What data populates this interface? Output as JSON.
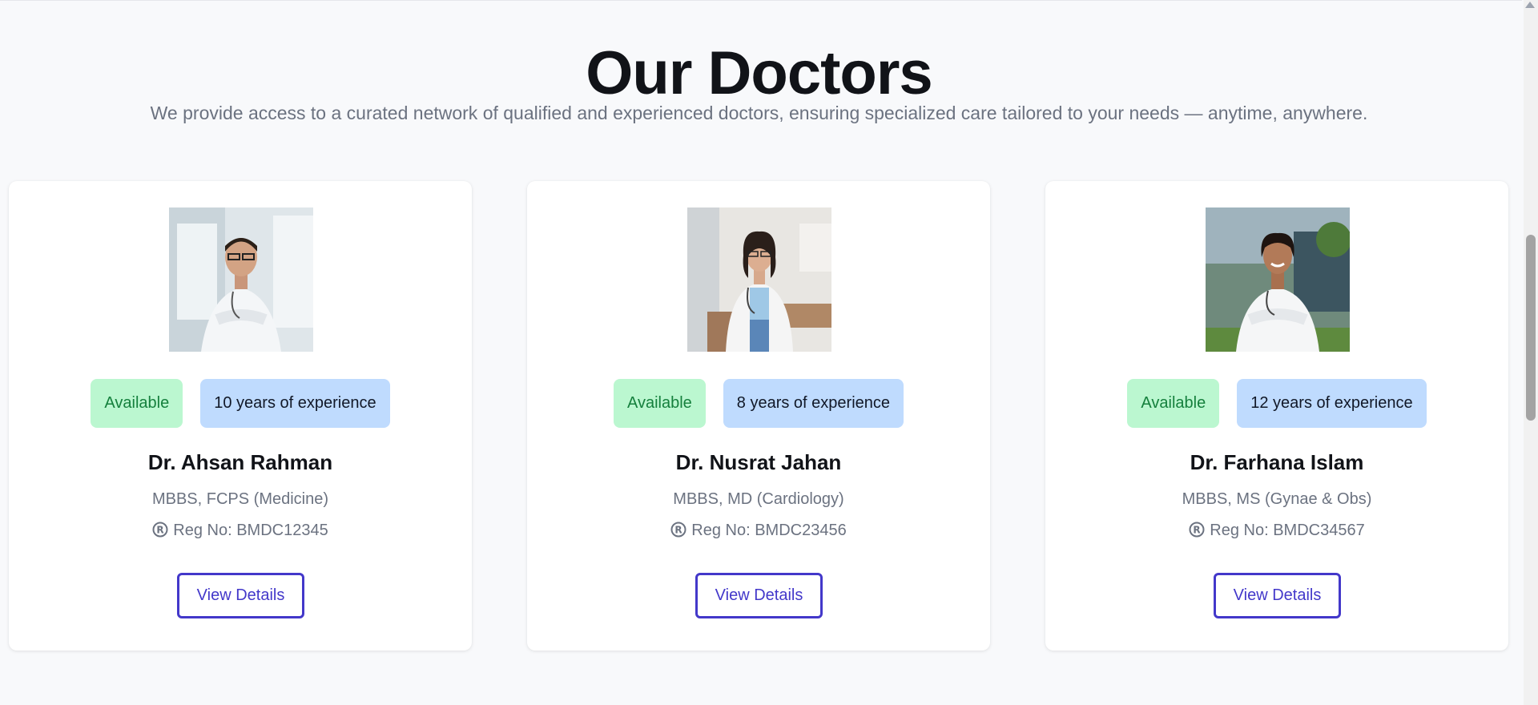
{
  "section": {
    "title": "Our Doctors",
    "subtitle": "We provide access to a curated network of qualified and experienced doctors, ensuring specialized care tailored to your needs — anytime, anywhere."
  },
  "doctors": [
    {
      "name": "Dr. Ahsan Rahman",
      "status": "Available",
      "experience": "10 years of experience",
      "degree": "MBBS, FCPS (Medicine)",
      "reg": "Reg No: BMDC12345",
      "button": "View Details"
    },
    {
      "name": "Dr. Nusrat Jahan",
      "status": "Available",
      "experience": "8 years of experience",
      "degree": "MBBS, MD (Cardiology)",
      "reg": "Reg No: BMDC23456",
      "button": "View Details"
    },
    {
      "name": "Dr. Farhana Islam",
      "status": "Available",
      "experience": "12 years of experience",
      "degree": "MBBS, MS (Gynae & Obs)",
      "reg": "Reg No: BMDC34567",
      "button": "View Details"
    }
  ],
  "colors": {
    "accent": "#4338ca",
    "available_bg": "#bbf7d0",
    "available_text": "#15803d",
    "experience_bg": "#bfdbfe"
  },
  "icons": {
    "registration": "registered-icon",
    "photo": "doctor-photo"
  }
}
